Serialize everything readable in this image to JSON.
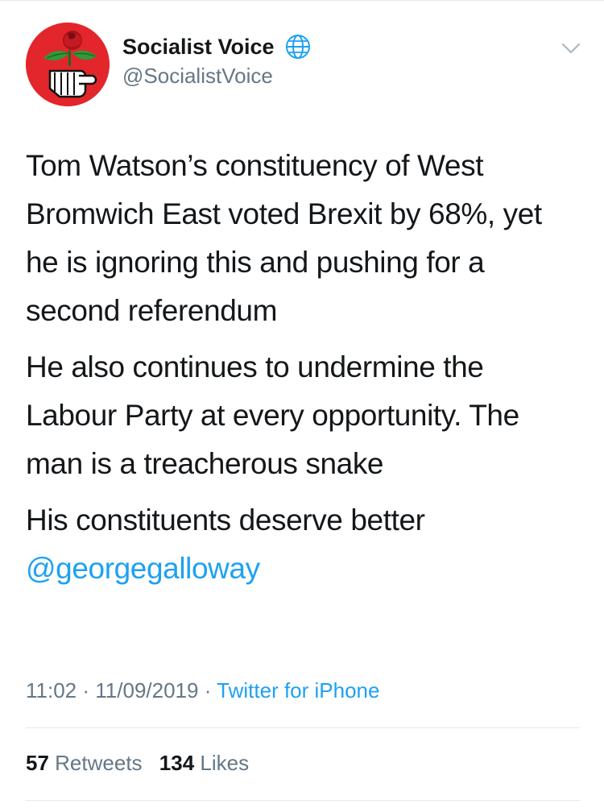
{
  "account": {
    "display_name": "Socialist Voice",
    "handle": "@SocialistVoice",
    "avatar_icon": "rose-fist-logo",
    "verified_icon": "globe-icon"
  },
  "tweet": {
    "paragraphs": [
      "Tom Watson’s constituency of West Bromwich East voted Brexit by 68%, yet he is ignoring this and pushing for a second referendum",
      "He also continues to undermine the Labour Party at every opportunity. The man is a treacherous snake",
      "His constituents deserve better"
    ],
    "mention": "@georgegalloway"
  },
  "meta": {
    "time": "11:02",
    "separator": "·",
    "date": "11/09/2019",
    "source": "Twitter for iPhone"
  },
  "stats": {
    "retweets_count": "57",
    "retweets_label": "Retweets",
    "likes_count": "134",
    "likes_label": "Likes"
  },
  "colors": {
    "link": "#1da1f2",
    "secondary_text": "#657786",
    "avatar_red": "#e3262b"
  }
}
